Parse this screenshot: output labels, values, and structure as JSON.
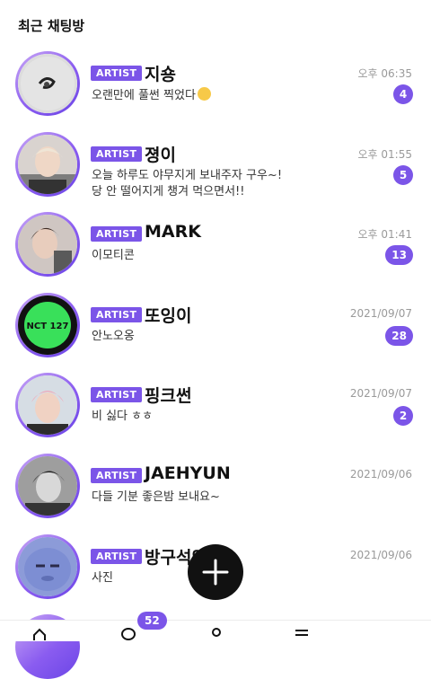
{
  "header": {
    "title": "최근 채팅방"
  },
  "chats": [
    {
      "badge": "ARTIST",
      "name": "지숑",
      "preview_lines": [
        "오랜만에 풀썬 찍었다"
      ],
      "has_emoji": true,
      "time": "오후 06:35",
      "unread": "4"
    },
    {
      "badge": "ARTIST",
      "name": "졍이",
      "preview_lines": [
        "오늘 하루도 야무지게 보내주자 구우~!",
        "당 안 떨어지게 챙겨 먹으면서!!"
      ],
      "has_emoji": false,
      "time": "오후 01:55",
      "unread": "5"
    },
    {
      "badge": "ARTIST",
      "name": "MARK",
      "preview_lines": [
        "이모티콘"
      ],
      "has_emoji": false,
      "time": "오후 01:41",
      "unread": "13"
    },
    {
      "badge": "ARTIST",
      "name": "또잉이",
      "preview_lines": [
        "안노오옹"
      ],
      "has_emoji": false,
      "time": "2021/09/07",
      "unread": "28"
    },
    {
      "badge": "ARTIST",
      "name": "핑크썬",
      "preview_lines": [
        "비 싫다 ㅎㅎ"
      ],
      "has_emoji": false,
      "time": "2021/09/07",
      "unread": "2"
    },
    {
      "badge": "ARTIST",
      "name": "JAEHYUN",
      "preview_lines": [
        "다들 기분 좋은밤 보내요~"
      ],
      "has_emoji": false,
      "time": "2021/09/06",
      "unread": ""
    },
    {
      "badge": "ARTIST",
      "name": "방구석인",
      "preview_lines": [
        "사진"
      ],
      "has_emoji": false,
      "time": "2021/09/06",
      "unread": ""
    }
  ],
  "avatar_labels": {
    "nct": "NCT 127"
  },
  "bottom_nav": {
    "badge_count": "52"
  },
  "colors": {
    "accent": "#7b55e8",
    "badge": "#7b55e8",
    "fab": "#111111"
  },
  "icons": [
    "plus-icon",
    "home-icon",
    "chat-icon",
    "profile-icon",
    "menu-icon"
  ]
}
